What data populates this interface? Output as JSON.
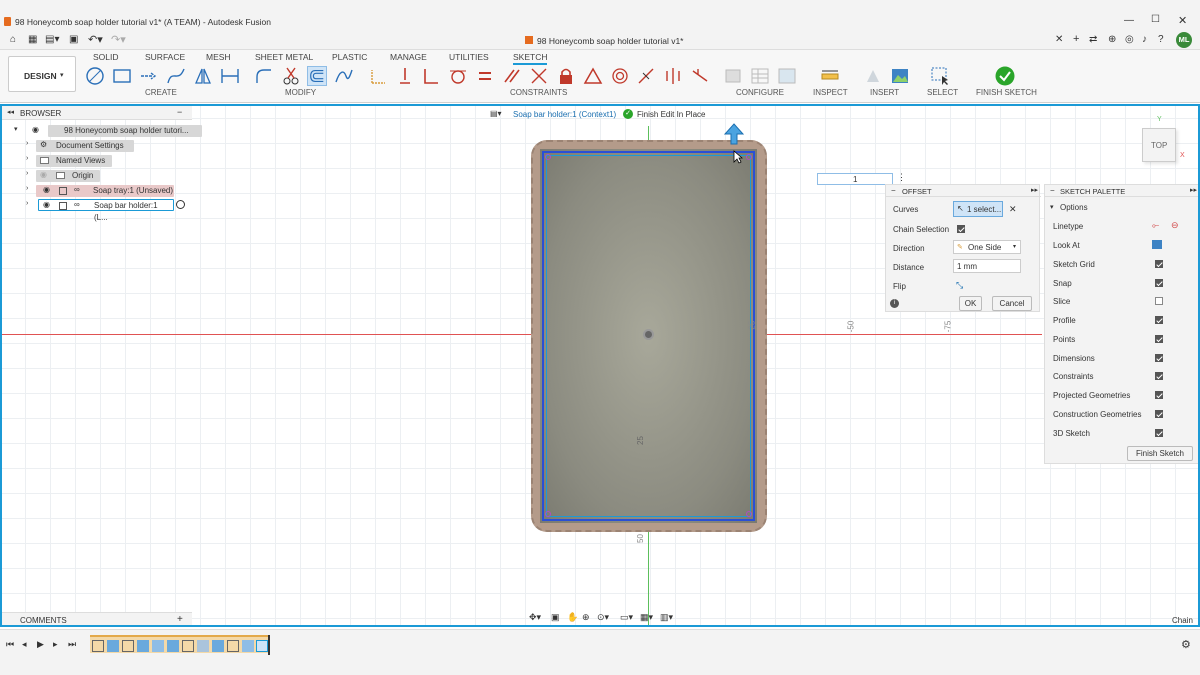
{
  "window": {
    "title": "98 Honeycomb soap holder tutorial v1* (A TEAM) - Autodesk Fusion"
  },
  "doc_tab": {
    "title": "98 Honeycomb soap holder tutorial v1*"
  },
  "user": {
    "initials": "ML"
  },
  "workspace": {
    "label": "DESIGN"
  },
  "ribbon_tabs": [
    "SOLID",
    "SURFACE",
    "MESH",
    "SHEET METAL",
    "PLASTIC",
    "MANAGE",
    "UTILITIES",
    "SKETCH"
  ],
  "ribbon_groups": [
    "CREATE",
    "MODIFY",
    "CONSTRAINTS",
    "CONFIGURE",
    "INSPECT",
    "INSERT",
    "SELECT",
    "FINISH SKETCH"
  ],
  "browser": {
    "title": "BROWSER",
    "items": [
      "98 Honeycomb soap holder tutori...",
      "Document Settings",
      "Named Views",
      "Origin",
      "Soap tray:1 (Unsaved)",
      "Soap bar holder:1 (L..."
    ]
  },
  "context": {
    "label": "Soap bar holder:1 (Context1)",
    "finish": "Finish Edit In Place"
  },
  "viewcube": {
    "label": "TOP",
    "axis_x": "X",
    "axis_y": "Y"
  },
  "canvas_labels": {
    "l1": "-50",
    "l2": "-75",
    "l3": "-25",
    "l4": "25",
    "l5": "50"
  },
  "input_value": "1",
  "offset": {
    "title": "OFFSET",
    "curves_label": "Curves",
    "curves_value": "1 select...",
    "chain_label": "Chain Selection",
    "direction_label": "Direction",
    "direction_value": "One Side",
    "distance_label": "Distance",
    "distance_value": "1 mm",
    "flip_label": "Flip",
    "ok": "OK",
    "cancel": "Cancel"
  },
  "palette": {
    "title": "SKETCH PALETTE",
    "options": "Options",
    "rows": [
      "Linetype",
      "Look At",
      "Sketch Grid",
      "Snap",
      "Slice",
      "Profile",
      "Points",
      "Dimensions",
      "Constraints",
      "Projected Geometries",
      "Construction Geometries",
      "3D Sketch"
    ],
    "finish": "Finish Sketch"
  },
  "comments": {
    "label": "COMMENTS"
  },
  "status": {
    "right": "Chain"
  }
}
